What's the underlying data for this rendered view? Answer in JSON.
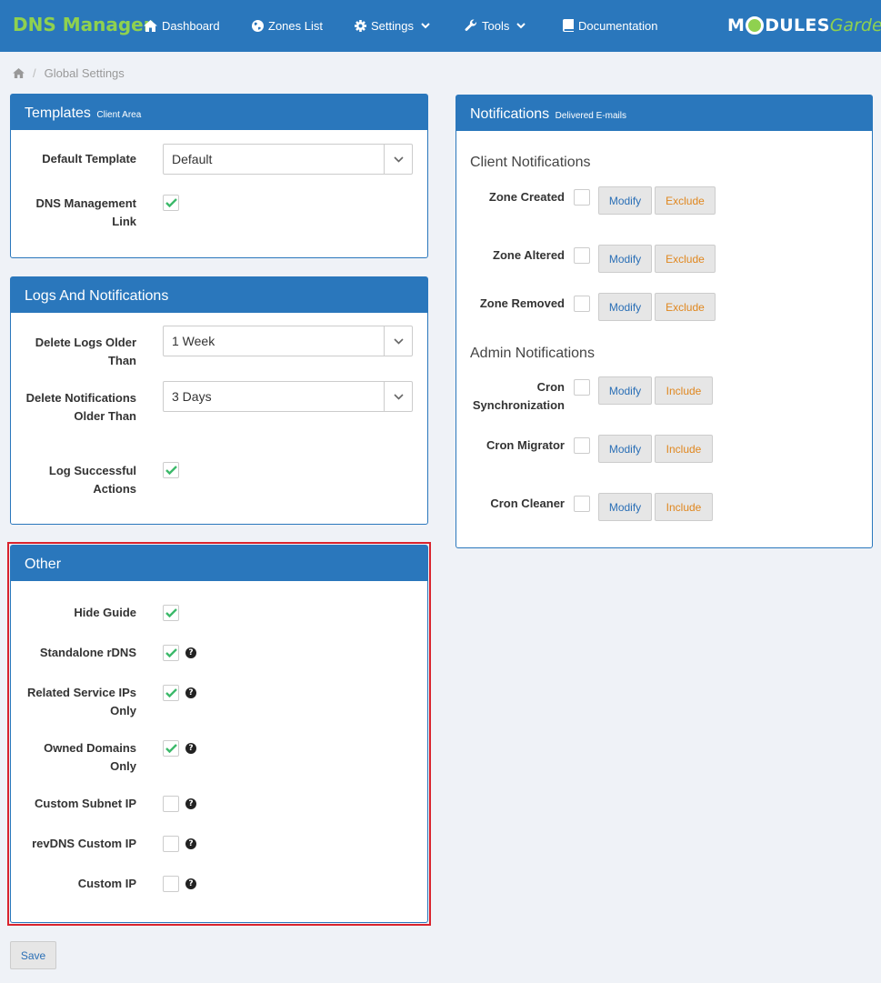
{
  "navbar": {
    "brand": "DNS Manager",
    "items": [
      {
        "label": "Dashboard",
        "icon": "home-icon"
      },
      {
        "label": "Zones List",
        "icon": "globe-icon"
      },
      {
        "label": "Settings",
        "icon": "gear-icon"
      },
      {
        "label": "Tools",
        "icon": "wrench-icon"
      },
      {
        "label": "Documentation",
        "icon": "book-icon"
      }
    ],
    "logo": {
      "modules_a": "M",
      "modules_b": "DULES",
      "garden": "Garden"
    }
  },
  "breadcrumb": {
    "separator": "/",
    "current": "Global Settings"
  },
  "templates": {
    "title": "Templates",
    "subtitle": "Client Area",
    "default_template_label": "Default Template",
    "default_template_value": "Default",
    "dns_link_label": "DNS Management Link",
    "dns_link_checked": true
  },
  "logs": {
    "title": "Logs And Notifications",
    "delete_logs_label": "Delete Logs Older Than",
    "delete_logs_value": "1 Week",
    "delete_notif_label": "Delete Notifications Older Than",
    "delete_notif_value": "3 Days",
    "log_success_label": "Log Successful Actions",
    "log_success_checked": true
  },
  "other": {
    "title": "Other",
    "options": [
      {
        "label": "Hide Guide",
        "checked": true,
        "help": false
      },
      {
        "label": "Standalone rDNS",
        "checked": true,
        "help": true
      },
      {
        "label": "Related Service IPs Only",
        "checked": true,
        "help": true
      },
      {
        "label": "Owned Domains Only",
        "checked": true,
        "help": true
      },
      {
        "label": "Custom Subnet IP",
        "checked": false,
        "help": true
      },
      {
        "label": "revDNS Custom IP",
        "checked": false,
        "help": true
      },
      {
        "label": "Custom IP",
        "checked": false,
        "help": true
      }
    ]
  },
  "notifications": {
    "title": "Notifications",
    "subtitle": "Delivered E-mails",
    "client_title": "Client Notifications",
    "admin_title": "Admin Notifications",
    "modify_label": "Modify",
    "exclude_label": "Exclude",
    "include_label": "Include",
    "client": [
      {
        "label": "Zone Created"
      },
      {
        "label": "Zone Altered"
      },
      {
        "label": "Zone Removed"
      }
    ],
    "admin": [
      {
        "label": "Cron Synchronization"
      },
      {
        "label": "Cron Migrator"
      },
      {
        "label": "Cron Cleaner"
      }
    ]
  },
  "save_label": "Save",
  "colors": {
    "primary": "#2a77bc",
    "brand_green": "#8fd14f",
    "check_green": "#3cb96a",
    "highlight_red": "#d9232d"
  }
}
